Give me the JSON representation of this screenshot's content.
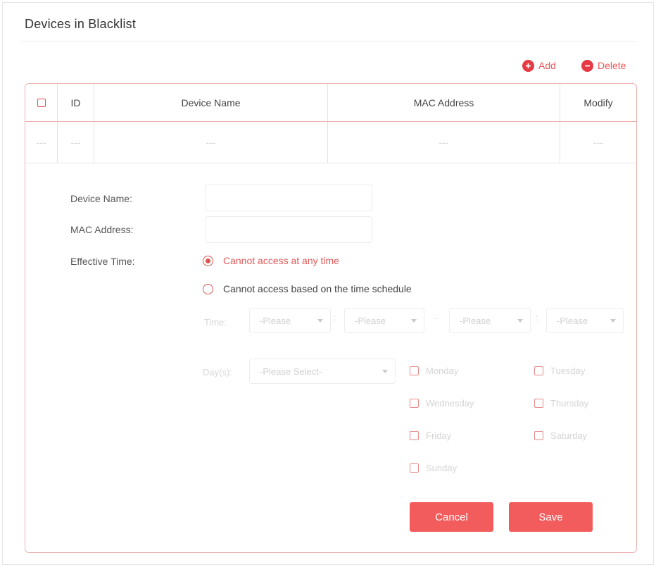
{
  "section": {
    "title": "Devices in Blacklist"
  },
  "toolbar": {
    "add_label": "Add",
    "delete_label": "Delete"
  },
  "table": {
    "headers": {
      "id": "ID",
      "device_name": "Device Name",
      "mac_address": "MAC Address",
      "modify": "Modify"
    },
    "empty_row": [
      "---",
      "---",
      "---",
      "---",
      "---"
    ]
  },
  "form": {
    "device_name_label": "Device Name:",
    "device_name_value": "",
    "mac_address_label": "MAC Address:",
    "mac_address_value": "",
    "effective_time_label": "Effective Time:",
    "options": [
      {
        "label": "Cannot access at any time",
        "selected": true
      },
      {
        "label": "Cannot access based on the time schedule",
        "selected": false
      }
    ],
    "time_label": "Time:",
    "time_selects": [
      "-Please",
      "-Please",
      "-Please",
      "-Please"
    ],
    "time_separators": [
      ":",
      "-",
      ":"
    ],
    "days_label": "Day(s):",
    "days_select": "-Please Select-",
    "days": [
      "Monday",
      "Tuesday",
      "Wednesday",
      "Thursday",
      "Friday",
      "Saturday",
      "Sunday"
    ]
  },
  "actions": {
    "cancel_label": "Cancel",
    "save_label": "Save"
  },
  "colors": {
    "accent": "#f25c5c",
    "icon_red": "#e53a44",
    "border_red": "#f0b0b0"
  },
  "icons": {
    "add": "plus-circle-icon",
    "delete": "minus-circle-icon"
  }
}
